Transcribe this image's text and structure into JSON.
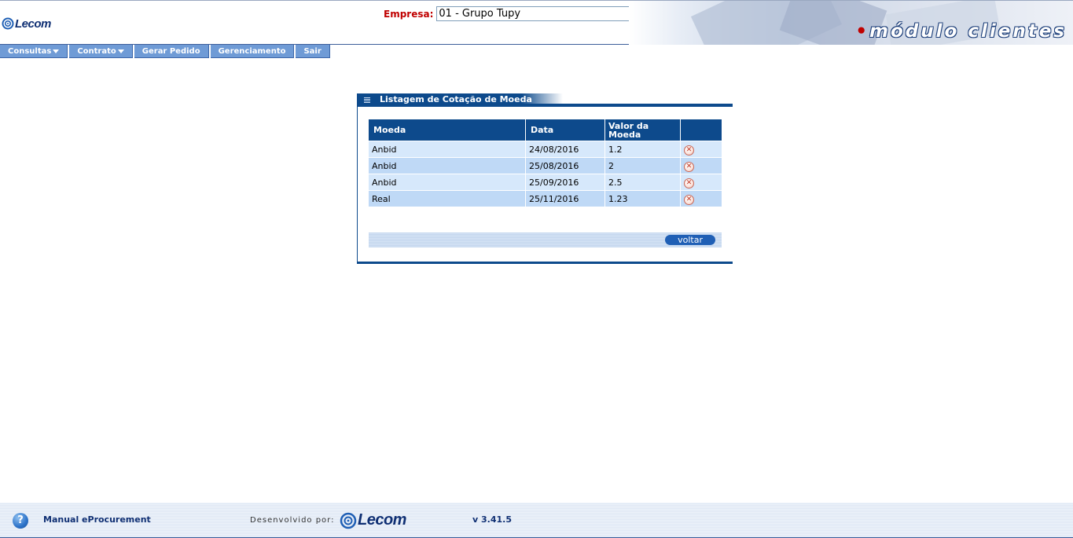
{
  "header": {
    "logo_text": "Lecom",
    "empresa_label": "Empresa:",
    "empresa_value": "01 - Grupo Tupy",
    "module_dot": "•",
    "module_title": "módulo clientes"
  },
  "menu": {
    "items": [
      {
        "label": "Consultas",
        "has_caret": true
      },
      {
        "label": "Contrato",
        "has_caret": true
      },
      {
        "label": "Gerar Pedido",
        "has_caret": false
      },
      {
        "label": "Gerenciamento",
        "has_caret": false
      },
      {
        "label": "Sair",
        "has_caret": false
      }
    ]
  },
  "panel": {
    "title": "Listagem de Cotação de Moeda",
    "columns": [
      "Moeda",
      "Data",
      "Valor da Moeda",
      ""
    ],
    "rows": [
      {
        "moeda": "Anbid",
        "data": "24/08/2016",
        "valor": "1.2"
      },
      {
        "moeda": "Anbid",
        "data": "25/08/2016",
        "valor": "2"
      },
      {
        "moeda": "Anbid",
        "data": "25/09/2016",
        "valor": "2.5"
      },
      {
        "moeda": "Real",
        "data": "25/11/2016",
        "valor": "1.23"
      }
    ],
    "voltar_label": "voltar"
  },
  "footer": {
    "help_symbol": "?",
    "manual_label": "Manual eProcurement",
    "developed_by": "Desenvolvido por:",
    "logo_text": "Lecom",
    "version": "v 3.41.5"
  },
  "icons": {
    "delete": "x-circle-icon",
    "help": "help-icon",
    "caret": "caret-down-icon"
  },
  "colors": {
    "primary_blue": "#0d4a8c",
    "menu_blue": "#6f9bd6",
    "row_a": "#d6e8fb",
    "row_b": "#bfd9f6",
    "empresa_label": "#c00000"
  }
}
